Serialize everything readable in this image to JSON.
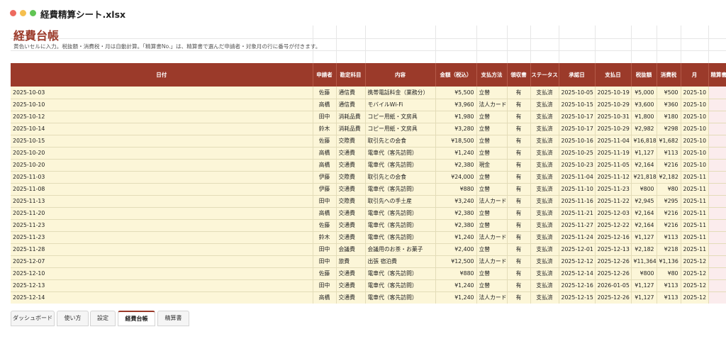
{
  "window": {
    "filename": "経費精算シート.xlsx"
  },
  "sheet": {
    "title": "経費台帳",
    "note": "黄色いセルに入力。税抜額・消費税・月は自動計算。「精算書No.」は、精算書で選んだ申請者・対象月の行に番号が付きます。"
  },
  "table": {
    "columns": [
      "日付",
      "申請者",
      "勘定科目",
      "内容",
      "金額（税込）",
      "支払方法",
      "領収書",
      "ステータス",
      "承認日",
      "支払日",
      "税抜額",
      "消費税",
      "月",
      "精算書"
    ],
    "rows": [
      [
        "2025-10-03",
        "佐藤",
        "通信費",
        "携帯電話料金（業務分）",
        "¥5,500",
        "立替",
        "有",
        "支払済",
        "2025-10-05",
        "2025-10-19",
        "¥5,000",
        "¥500",
        "2025-10",
        ""
      ],
      [
        "2025-10-10",
        "高橋",
        "通信費",
        "モバイルWi-Fi",
        "¥3,960",
        "法人カード",
        "有",
        "支払済",
        "2025-10-15",
        "2025-10-29",
        "¥3,600",
        "¥360",
        "2025-10",
        ""
      ],
      [
        "2025-10-12",
        "田中",
        "消耗品費",
        "コピー用紙・文房具",
        "¥1,980",
        "立替",
        "有",
        "支払済",
        "2025-10-17",
        "2025-10-31",
        "¥1,800",
        "¥180",
        "2025-10",
        ""
      ],
      [
        "2025-10-14",
        "鈴木",
        "消耗品費",
        "コピー用紙・文房具",
        "¥3,280",
        "立替",
        "有",
        "支払済",
        "2025-10-17",
        "2025-10-29",
        "¥2,982",
        "¥298",
        "2025-10",
        ""
      ],
      [
        "2025-10-15",
        "佐藤",
        "交際費",
        "取引先との会食",
        "¥18,500",
        "立替",
        "有",
        "支払済",
        "2025-10-16",
        "2025-11-04",
        "¥16,818",
        "¥1,682",
        "2025-10",
        ""
      ],
      [
        "2025-10-20",
        "高橋",
        "交通費",
        "電車代（客先訪問）",
        "¥1,240",
        "立替",
        "有",
        "支払済",
        "2025-10-25",
        "2025-11-19",
        "¥1,127",
        "¥113",
        "2025-10",
        ""
      ],
      [
        "2025-10-20",
        "高橋",
        "交通費",
        "電車代（客先訪問）",
        "¥2,380",
        "現金",
        "有",
        "支払済",
        "2025-10-23",
        "2025-11-05",
        "¥2,164",
        "¥216",
        "2025-10",
        ""
      ],
      [
        "2025-11-03",
        "伊藤",
        "交際費",
        "取引先との会食",
        "¥24,000",
        "立替",
        "有",
        "支払済",
        "2025-11-04",
        "2025-11-12",
        "¥21,818",
        "¥2,182",
        "2025-11",
        ""
      ],
      [
        "2025-11-08",
        "伊藤",
        "交通費",
        "電車代（客先訪問）",
        "¥880",
        "立替",
        "有",
        "支払済",
        "2025-11-10",
        "2025-11-23",
        "¥800",
        "¥80",
        "2025-11",
        ""
      ],
      [
        "2025-11-13",
        "田中",
        "交際費",
        "取引先への手土産",
        "¥3,240",
        "法人カード",
        "有",
        "支払済",
        "2025-11-16",
        "2025-11-22",
        "¥2,945",
        "¥295",
        "2025-11",
        ""
      ],
      [
        "2025-11-20",
        "高橋",
        "交通費",
        "電車代（客先訪問）",
        "¥2,380",
        "立替",
        "有",
        "支払済",
        "2025-11-21",
        "2025-12-03",
        "¥2,164",
        "¥216",
        "2025-11",
        ""
      ],
      [
        "2025-11-23",
        "佐藤",
        "交通費",
        "電車代（客先訪問）",
        "¥2,380",
        "立替",
        "有",
        "支払済",
        "2025-11-27",
        "2025-12-22",
        "¥2,164",
        "¥216",
        "2025-11",
        ""
      ],
      [
        "2025-11-23",
        "鈴木",
        "交通費",
        "電車代（客先訪問）",
        "¥1,240",
        "法人カード",
        "有",
        "支払済",
        "2025-11-24",
        "2025-12-16",
        "¥1,127",
        "¥113",
        "2025-11",
        ""
      ],
      [
        "2025-11-28",
        "田中",
        "会議費",
        "会議用のお茶・お菓子",
        "¥2,400",
        "立替",
        "有",
        "支払済",
        "2025-12-01",
        "2025-12-13",
        "¥2,182",
        "¥218",
        "2025-11",
        ""
      ],
      [
        "2025-12-07",
        "田中",
        "旅費",
        "出張 宿泊費",
        "¥12,500",
        "法人カード",
        "有",
        "支払済",
        "2025-12-12",
        "2025-12-26",
        "¥11,364",
        "¥1,136",
        "2025-12",
        ""
      ],
      [
        "2025-12-10",
        "佐藤",
        "交通費",
        "電車代（客先訪問）",
        "¥880",
        "立替",
        "有",
        "支払済",
        "2025-12-14",
        "2025-12-26",
        "¥800",
        "¥80",
        "2025-12",
        ""
      ],
      [
        "2025-12-13",
        "田中",
        "交通費",
        "電車代（客先訪問）",
        "¥1,240",
        "立替",
        "有",
        "支払済",
        "2025-12-16",
        "2026-01-05",
        "¥1,127",
        "¥113",
        "2025-12",
        ""
      ],
      [
        "2025-12-14",
        "高橋",
        "交通費",
        "電車代（客先訪問）",
        "¥1,240",
        "法人カード",
        "有",
        "支払済",
        "2025-12-15",
        "2025-12-26",
        "¥1,127",
        "¥113",
        "2025-12",
        ""
      ]
    ]
  },
  "tabs": [
    {
      "label": "ダッシュボード",
      "active": false
    },
    {
      "label": "使い方",
      "active": false
    },
    {
      "label": "設定",
      "active": false
    },
    {
      "label": "経費台帳",
      "active": true
    },
    {
      "label": "精算書",
      "active": false
    }
  ],
  "colors": {
    "header": "#9b3a2a",
    "input_cell": "#fcf6d8",
    "calc_cell": "#fbeced",
    "title": "#9b3a2a"
  }
}
